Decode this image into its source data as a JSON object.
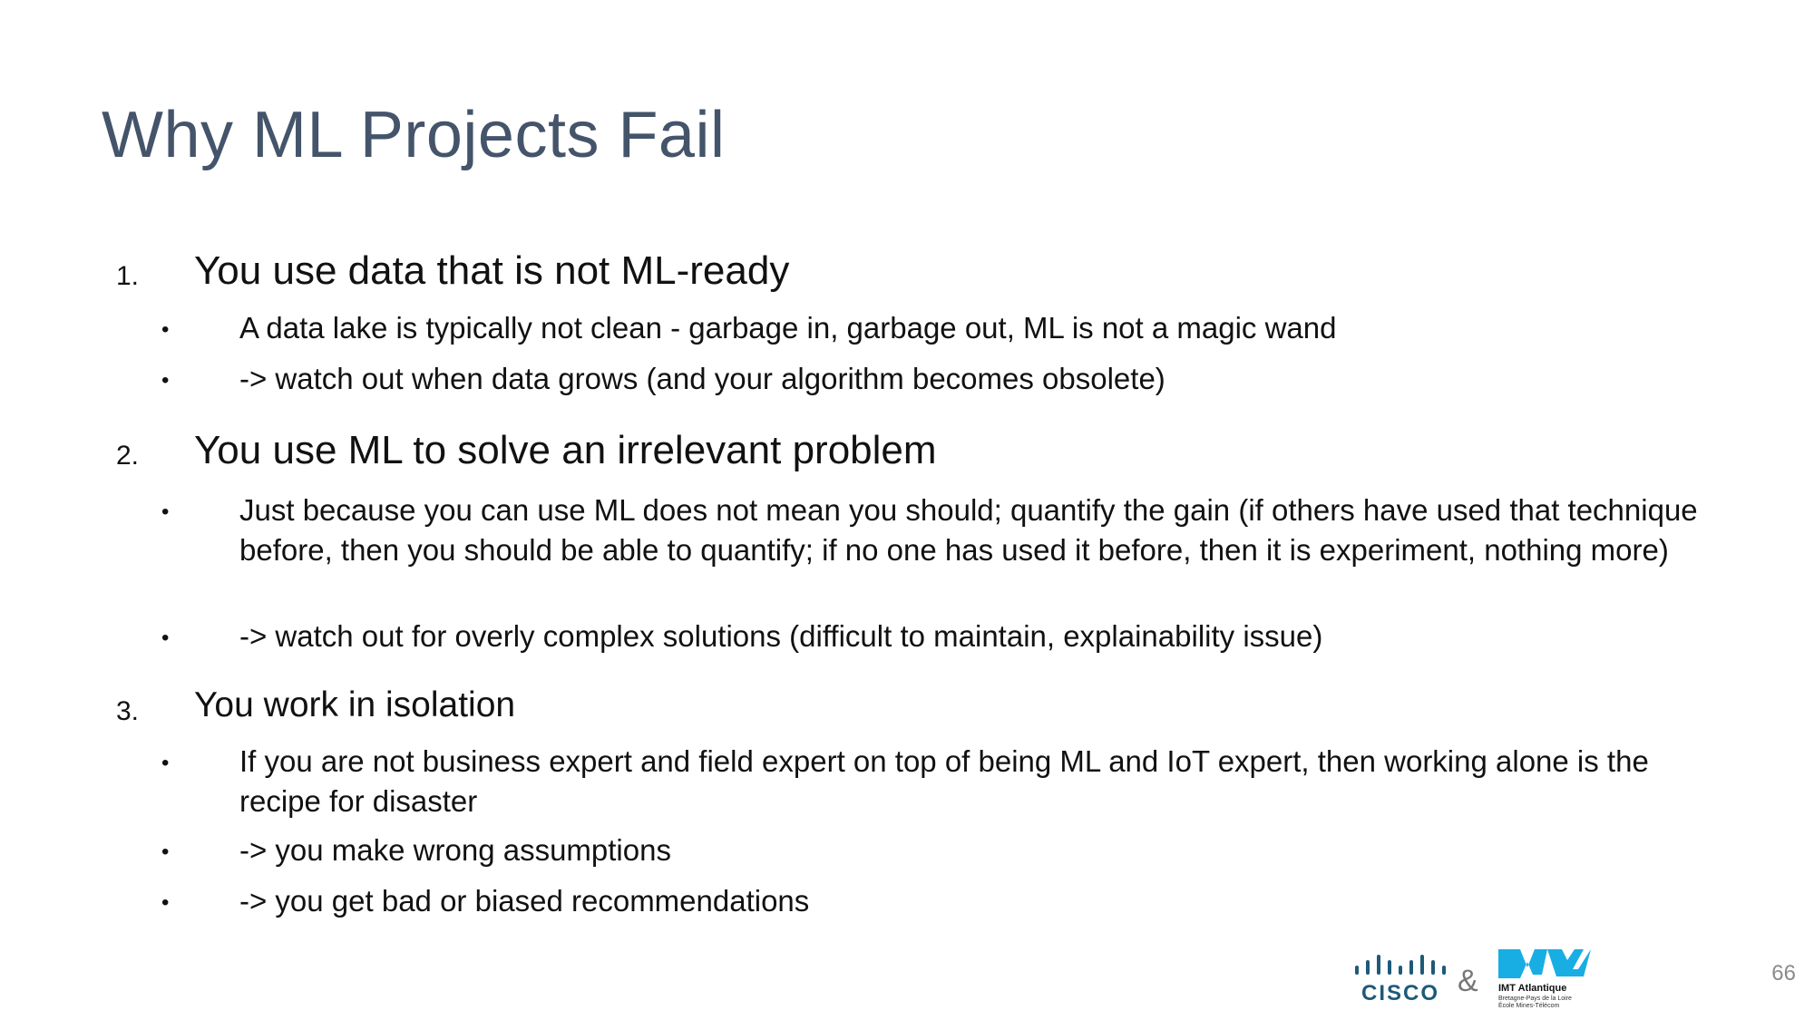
{
  "slide": {
    "title": "Why ML Projects Fail",
    "items": [
      {
        "number": "1.",
        "heading": "You use data that is not ML-ready",
        "bullets": [
          "A data lake is typically not clean -  garbage in, garbage out, ML is not a magic wand",
          "-> watch out when data grows (and your algorithm becomes obsolete)"
        ]
      },
      {
        "number": "2.",
        "heading": "You use ML to solve an irrelevant problem",
        "bullets": [
          "Just because you can use ML does not mean you should; quantify the gain (if others have used that technique before, then you should be able to quantify; if no one has used it before, then it is experiment, nothing more)",
          "-> watch out for overly complex solutions (difficult to maintain, explainability issue)"
        ]
      },
      {
        "number": "3.",
        "heading": "You work in isolation",
        "bullets": [
          "If you are not business expert and field expert on top of being ML and IoT expert, then working alone is the recipe for disaster",
          "-> you make wrong assumptions",
          "-> you get bad or biased recommendations"
        ]
      }
    ],
    "bullet_symbol": "•"
  },
  "footer": {
    "cisco_logo_text": "CISCO",
    "ampersand": "&",
    "imt_logo_name": "IMT Atlantique",
    "imt_logo_line2": "Bretagne-Pays de la Loire",
    "imt_logo_line3": "École Mines-Télécom",
    "page_number": "66"
  },
  "colors": {
    "title": "#44546a",
    "text": "#111111",
    "cisco_blue": "#1d5a7a",
    "imt_cyan": "#18aee3",
    "page_number": "#8a8a8a"
  }
}
